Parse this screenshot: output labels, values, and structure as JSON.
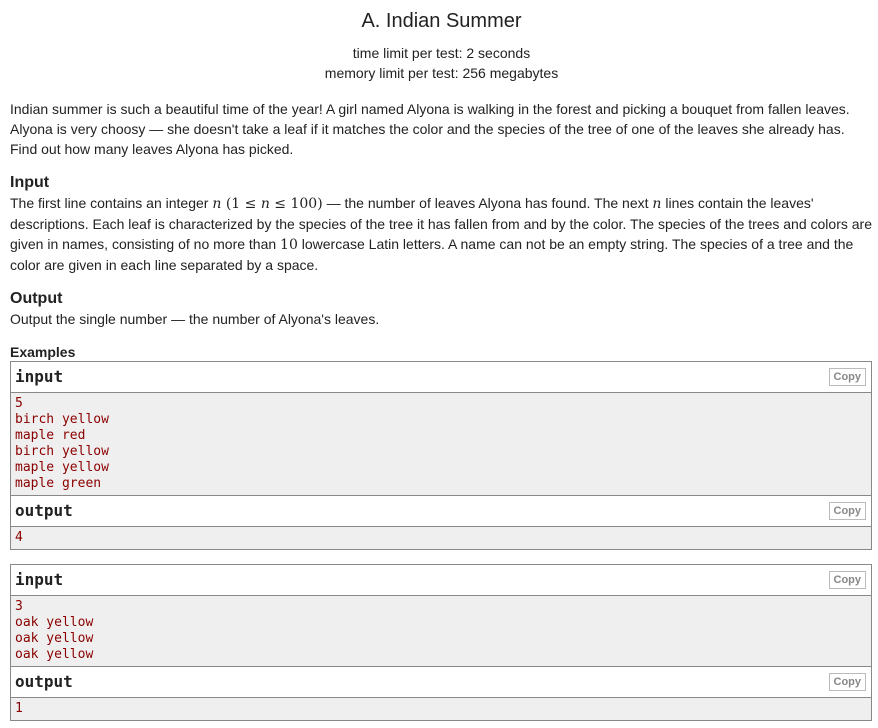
{
  "problem": {
    "title": "A. Indian Summer",
    "time_limit": "time limit per test: 2 seconds",
    "memory_limit": "memory limit per test: 256 megabytes"
  },
  "statement": {
    "line1": "Indian summer is such a beautiful time of the year! A girl named Alyona is walking in the forest and picking a bouquet from fallen leaves.",
    "line2": "Alyona is very choosy — she doesn't take a leaf if it matches the color and the species of the tree of one of the leaves she already has.",
    "line3": "Find out how many leaves Alyona has picked."
  },
  "input_section": {
    "title": "Input",
    "text_a": "The first line contains an integer ",
    "math_n": "n",
    "math_range_open": " (1 ≤ ",
    "math_range_n": "n",
    "math_range_close": " ≤ 100)",
    "text_b": " — the number of leaves Alyona has found. The next ",
    "math_n2": "n",
    "text_c": " lines contain the leaves' descriptions. Each leaf is characterized by the species of the tree it has fallen from and by the color. The species of the trees and colors are given in names, consisting of no more than ",
    "math_10": "10",
    "text_d": " lowercase Latin letters. A name can not be an empty string. The species of a tree and the color are given in each line separated by a space."
  },
  "output_section": {
    "title": "Output",
    "text": "Output the single number — the number of Alyona's leaves."
  },
  "examples": {
    "title": "Examples",
    "input_label": "input",
    "output_label": "output",
    "copy_label": "Copy",
    "items": [
      {
        "input": [
          "5",
          "birch yellow",
          "maple red",
          "birch yellow",
          "maple yellow",
          "maple green"
        ],
        "output": [
          "4"
        ]
      },
      {
        "input": [
          "3",
          "oak yellow",
          "oak yellow",
          "oak yellow"
        ],
        "output": [
          "1"
        ]
      }
    ]
  },
  "colors": {
    "sample_text": "#8b0000",
    "sample_bg": "#efefef",
    "border": "#888888"
  }
}
